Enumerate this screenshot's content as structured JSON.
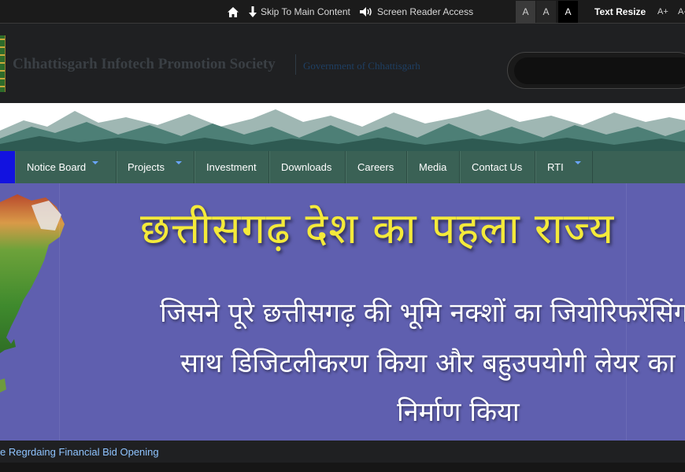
{
  "topbar": {
    "skip_label": "Skip To Main Content",
    "reader_label": "Screen Reader Access",
    "font_sizes": [
      "A",
      "A",
      "A"
    ],
    "text_resize_label": "Text Resize",
    "increase_label": "A+",
    "decrease_label": "A-"
  },
  "header": {
    "org_name": "Chhattisgarh Infotech Promotion Society",
    "gov_name": "Government of Chhattisgarh",
    "search_placeholder": ""
  },
  "nav": {
    "items": [
      {
        "label": "Notice Board",
        "dropdown": true
      },
      {
        "label": "Projects",
        "dropdown": true
      },
      {
        "label": "Investment",
        "dropdown": false
      },
      {
        "label": "Downloads",
        "dropdown": false
      },
      {
        "label": "Careers",
        "dropdown": false
      },
      {
        "label": "Media",
        "dropdown": false
      },
      {
        "label": "Contact Us",
        "dropdown": false
      },
      {
        "label": "RTI",
        "dropdown": true
      }
    ]
  },
  "banner": {
    "title": "छत्तीसगढ़ देश का पहला राज्य",
    "line1": "जिसने पूरे छत्तीसगढ़ की भूमि नक्शों का जियोरिफरेंसिंग के",
    "line2": "साथ डिजिटलीकरण किया और बहुउपयोगी लेयर का",
    "line3": "निर्माण किया"
  },
  "ticker": {
    "text": "e Regrdaing Financial Bid Opening"
  },
  "colors": {
    "nav_bg": "#3a6155",
    "banner_bg": "#5f5faf",
    "banner_title": "#f4ea3a",
    "ticker_text": "#8fc4ff",
    "nav_first": "#1212e0"
  }
}
